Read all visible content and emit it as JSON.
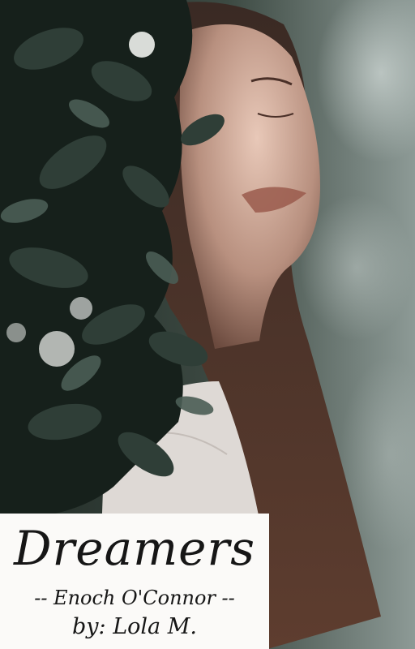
{
  "cover": {
    "title": "Dreamers",
    "author_line": "-- Enoch O'Connor --",
    "byline": "by: Lola M."
  }
}
